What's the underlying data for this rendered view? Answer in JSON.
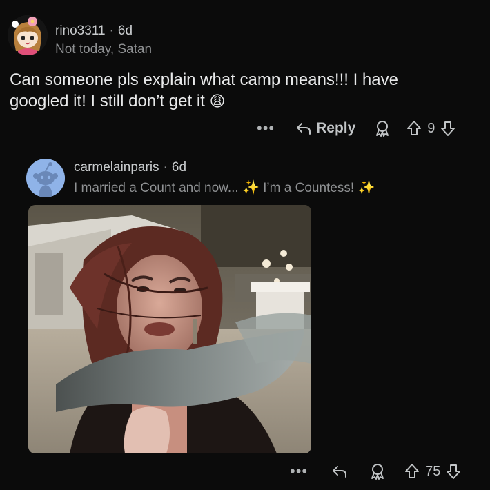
{
  "comment1": {
    "username": "rino3311",
    "separator": "·",
    "age": "6d",
    "flair": "Not today, Satan",
    "body_line1": "Can someone pls explain what camp means!!! I have",
    "body_line2": "googled it! I still don’t get it",
    "body_emoji": "😩",
    "actions": {
      "more": "•••",
      "reply_label": "Reply",
      "score": "9"
    }
  },
  "comment2": {
    "username": "carmelainparis",
    "separator": "·",
    "age": "6d",
    "flair_part1": "I married a Count and now...",
    "flair_sparkle1": "✨",
    "flair_part2": "I’m a Countess!",
    "flair_sparkle2": "✨",
    "media": {
      "type": "gif",
      "subject": "woman with hair and scarf blowing in wind"
    },
    "actions": {
      "more": "•••",
      "score": "75"
    }
  },
  "colors": {
    "background": "#0b0b0b",
    "text": "#e8e9ea",
    "muted": "#8f9193",
    "avatar_blue": "#8fb3e8"
  },
  "icons": [
    "avatar-anime",
    "snoo-avatar",
    "reply-icon",
    "award-icon",
    "upvote-icon",
    "downvote-icon",
    "more-dots-icon"
  ]
}
